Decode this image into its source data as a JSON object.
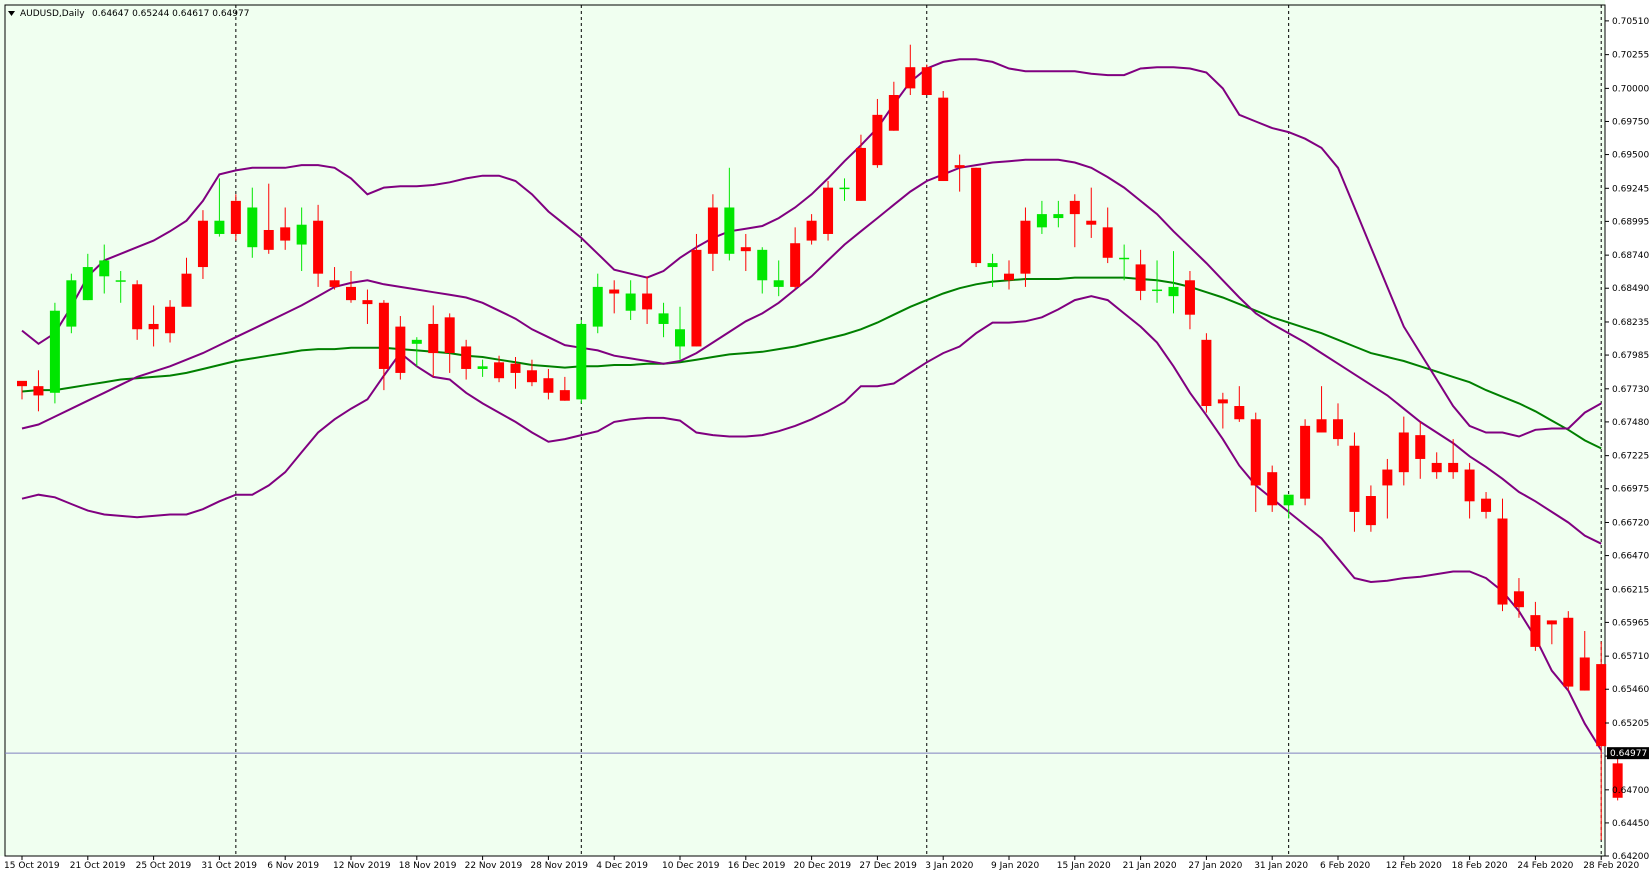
{
  "header": {
    "symbol": "AUDUSD,Daily",
    "ohlc": "0.64647 0.65244 0.64617 0.64977"
  },
  "colors": {
    "background": "#f0fff0",
    "bull": "#00e600",
    "bear": "#ff0000",
    "bands": "#800080",
    "ma": "#008000",
    "bid_line": "#8080c0",
    "grid": "#000000"
  },
  "current_price_label": "0.64977",
  "chart_data": {
    "type": "candlestick",
    "title": "AUDUSD,Daily",
    "ylim": [
      0.642,
      0.7063
    ],
    "y_ticks": [
      "0.70510",
      "0.70255",
      "0.70000",
      "0.69750",
      "0.69500",
      "0.69245",
      "0.68995",
      "0.68740",
      "0.68490",
      "0.68235",
      "0.67985",
      "0.67730",
      "0.67480",
      "0.67225",
      "0.66975",
      "0.66720",
      "0.66470",
      "0.66215",
      "0.65965",
      "0.65710",
      "0.65460",
      "0.65205",
      "0.64955",
      "0.64700",
      "0.64450",
      "0.64200"
    ],
    "x_labels": [
      {
        "i": 0,
        "t": "15 Oct 2019"
      },
      {
        "i": 4,
        "t": "21 Oct 2019"
      },
      {
        "i": 8,
        "t": "25 Oct 2019"
      },
      {
        "i": 12,
        "t": "31 Oct 2019"
      },
      {
        "i": 16,
        "t": "6 Nov 2019"
      },
      {
        "i": 20,
        "t": "12 Nov 2019"
      },
      {
        "i": 24,
        "t": "18 Nov 2019"
      },
      {
        "i": 28,
        "t": "22 Nov 2019"
      },
      {
        "i": 32,
        "t": "28 Nov 2019"
      },
      {
        "i": 36,
        "t": "4 Dec 2019"
      },
      {
        "i": 40,
        "t": "10 Dec 2019"
      },
      {
        "i": 44,
        "t": "16 Dec 2019"
      },
      {
        "i": 48,
        "t": "20 Dec 2019"
      },
      {
        "i": 52,
        "t": "27 Dec 2019"
      },
      {
        "i": 56,
        "t": "3 Jan 2020"
      },
      {
        "i": 60,
        "t": "9 Jan 2020"
      },
      {
        "i": 64,
        "t": "15 Jan 2020"
      },
      {
        "i": 68,
        "t": "21 Jan 2020"
      },
      {
        "i": 72,
        "t": "27 Jan 2020"
      },
      {
        "i": 76,
        "t": "31 Jan 2020"
      },
      {
        "i": 80,
        "t": "6 Feb 2020"
      },
      {
        "i": 84,
        "t": "12 Feb 2020"
      },
      {
        "i": 88,
        "t": "18 Feb 2020"
      },
      {
        "i": 92,
        "t": "24 Feb 2020"
      },
      {
        "i": 96,
        "t": "28 Feb 2020"
      }
    ],
    "period_separators": [
      13,
      34,
      55,
      77,
      96
    ],
    "current_price": 0.64977,
    "candles": [
      [
        0.6779,
        0.6778,
        0.6765,
        0.6775
      ],
      [
        0.6775,
        0.6787,
        0.6756,
        0.6768
      ],
      [
        0.677,
        0.6838,
        0.6762,
        0.6832
      ],
      [
        0.682,
        0.686,
        0.6815,
        0.6855
      ],
      [
        0.684,
        0.6875,
        0.684,
        0.6865
      ],
      [
        0.6858,
        0.6882,
        0.6845,
        0.687
      ],
      [
        0.6855,
        0.6862,
        0.6838,
        0.6855
      ],
      [
        0.6852,
        0.6855,
        0.681,
        0.6818
      ],
      [
        0.6822,
        0.6836,
        0.6805,
        0.6818
      ],
      [
        0.6835,
        0.684,
        0.6808,
        0.6815
      ],
      [
        0.686,
        0.6872,
        0.6845,
        0.6835
      ],
      [
        0.69,
        0.6908,
        0.6856,
        0.6865
      ],
      [
        0.689,
        0.6932,
        0.6888,
        0.69
      ],
      [
        0.6915,
        0.692,
        0.6885,
        0.689
      ],
      [
        0.688,
        0.6925,
        0.6872,
        0.691
      ],
      [
        0.6893,
        0.6928,
        0.6875,
        0.6878
      ],
      [
        0.6895,
        0.691,
        0.6878,
        0.6885
      ],
      [
        0.6882,
        0.691,
        0.6862,
        0.6897
      ],
      [
        0.69,
        0.6912,
        0.685,
        0.686
      ],
      [
        0.6855,
        0.6865,
        0.6848,
        0.685
      ],
      [
        0.685,
        0.6862,
        0.6838,
        0.684
      ],
      [
        0.684,
        0.6848,
        0.6822,
        0.6837
      ],
      [
        0.6838,
        0.684,
        0.6772,
        0.6788
      ],
      [
        0.682,
        0.6828,
        0.678,
        0.6785
      ],
      [
        0.6807,
        0.6812,
        0.679,
        0.681
      ],
      [
        0.6822,
        0.6836,
        0.6782,
        0.68
      ],
      [
        0.6827,
        0.683,
        0.6785,
        0.68
      ],
      [
        0.6805,
        0.681,
        0.678,
        0.6788
      ],
      [
        0.6788,
        0.6795,
        0.6782,
        0.679
      ],
      [
        0.6793,
        0.6798,
        0.6778,
        0.6781
      ],
      [
        0.6792,
        0.6797,
        0.6773,
        0.6785
      ],
      [
        0.6787,
        0.6795,
        0.6775,
        0.6778
      ],
      [
        0.6781,
        0.6788,
        0.6765,
        0.677
      ],
      [
        0.6772,
        0.6782,
        0.6764,
        0.6764
      ],
      [
        0.6765,
        0.6825,
        0.6762,
        0.6822
      ],
      [
        0.682,
        0.686,
        0.6815,
        0.685
      ],
      [
        0.6848,
        0.6855,
        0.683,
        0.6845
      ],
      [
        0.6832,
        0.6855,
        0.6825,
        0.6845
      ],
      [
        0.6845,
        0.6858,
        0.6822,
        0.6833
      ],
      [
        0.6822,
        0.6838,
        0.6812,
        0.683
      ],
      [
        0.6805,
        0.6835,
        0.6795,
        0.6818
      ],
      [
        0.6878,
        0.689,
        0.6805,
        0.6805
      ],
      [
        0.691,
        0.692,
        0.6862,
        0.6875
      ],
      [
        0.6875,
        0.694,
        0.687,
        0.691
      ],
      [
        0.688,
        0.689,
        0.6862,
        0.6877
      ],
      [
        0.6855,
        0.688,
        0.6845,
        0.6878
      ],
      [
        0.685,
        0.687,
        0.6843,
        0.6855
      ],
      [
        0.6883,
        0.6895,
        0.6848,
        0.685
      ],
      [
        0.69,
        0.6905,
        0.6882,
        0.6885
      ],
      [
        0.6925,
        0.693,
        0.6885,
        0.689
      ],
      [
        0.6925,
        0.6932,
        0.6915,
        0.6925
      ],
      [
        0.6955,
        0.6965,
        0.6915,
        0.6915
      ],
      [
        0.698,
        0.6992,
        0.694,
        0.6942
      ],
      [
        0.6995,
        0.7005,
        0.6968,
        0.6968
      ],
      [
        0.7016,
        0.7033,
        0.6995,
        0.7
      ],
      [
        0.7016,
        0.7018,
        0.6995,
        0.6995
      ],
      [
        0.6993,
        0.6998,
        0.693,
        0.693
      ],
      [
        0.6942,
        0.695,
        0.6922,
        0.694
      ],
      [
        0.694,
        0.694,
        0.6865,
        0.6868
      ],
      [
        0.6865,
        0.6875,
        0.685,
        0.6868
      ],
      [
        0.686,
        0.687,
        0.6848,
        0.6855
      ],
      [
        0.69,
        0.691,
        0.685,
        0.686
      ],
      [
        0.6895,
        0.6915,
        0.689,
        0.6905
      ],
      [
        0.6902,
        0.6915,
        0.6895,
        0.6905
      ],
      [
        0.6915,
        0.692,
        0.688,
        0.6905
      ],
      [
        0.69,
        0.6925,
        0.6887,
        0.6897
      ],
      [
        0.6895,
        0.691,
        0.6868,
        0.6872
      ],
      [
        0.6872,
        0.6882,
        0.6855,
        0.6872
      ],
      [
        0.6867,
        0.6878,
        0.684,
        0.6847
      ],
      [
        0.6848,
        0.687,
        0.6838,
        0.6848
      ],
      [
        0.6843,
        0.6877,
        0.683,
        0.685
      ],
      [
        0.6855,
        0.6862,
        0.6818,
        0.6829
      ],
      [
        0.681,
        0.6815,
        0.6755,
        0.676
      ],
      [
        0.6765,
        0.677,
        0.6743,
        0.6762
      ],
      [
        0.676,
        0.6775,
        0.6748,
        0.675
      ],
      [
        0.675,
        0.6755,
        0.668,
        0.67
      ],
      [
        0.671,
        0.6715,
        0.668,
        0.6685
      ],
      [
        0.6685,
        0.6693,
        0.6675,
        0.6693
      ],
      [
        0.6745,
        0.675,
        0.6685,
        0.669
      ],
      [
        0.675,
        0.6775,
        0.674,
        0.674
      ],
      [
        0.675,
        0.6762,
        0.673,
        0.6735
      ],
      [
        0.673,
        0.674,
        0.6665,
        0.668
      ],
      [
        0.6692,
        0.67,
        0.6665,
        0.667
      ],
      [
        0.6712,
        0.672,
        0.6675,
        0.67
      ],
      [
        0.674,
        0.6752,
        0.67,
        0.671
      ],
      [
        0.6738,
        0.6748,
        0.6705,
        0.672
      ],
      [
        0.6717,
        0.6725,
        0.6705,
        0.671
      ],
      [
        0.6717,
        0.6735,
        0.6705,
        0.671
      ],
      [
        0.6712,
        0.6717,
        0.6675,
        0.6688
      ],
      [
        0.669,
        0.6695,
        0.6675,
        0.668
      ],
      [
        0.6675,
        0.669,
        0.6605,
        0.661
      ],
      [
        0.662,
        0.663,
        0.66,
        0.6608
      ],
      [
        0.6602,
        0.6612,
        0.6575,
        0.6578
      ],
      [
        0.6598,
        0.6598,
        0.658,
        0.6595
      ],
      [
        0.66,
        0.6605,
        0.6545,
        0.6548
      ],
      [
        0.657,
        0.659,
        0.6545,
        0.6545
      ],
      [
        0.6565,
        0.6582,
        0.6432,
        0.6503
      ],
      [
        0.649,
        0.6498,
        0.6462,
        0.6464
      ]
    ],
    "bands_upper": [
      0.6817,
      0.6807,
      0.6815,
      0.6835,
      0.6858,
      0.687,
      0.6875,
      0.688,
      0.6885,
      0.6892,
      0.69,
      0.6915,
      0.6935,
      0.6938,
      0.694,
      0.694,
      0.694,
      0.6942,
      0.6942,
      0.694,
      0.6932,
      0.692,
      0.6925,
      0.6926,
      0.6926,
      0.6927,
      0.6929,
      0.6932,
      0.6934,
      0.6934,
      0.693,
      0.692,
      0.6907,
      0.6897,
      0.6887,
      0.6875,
      0.6863,
      0.686,
      0.6857,
      0.6862,
      0.6872,
      0.688,
      0.6887,
      0.6892,
      0.6894,
      0.6896,
      0.6902,
      0.691,
      0.692,
      0.6932,
      0.6945,
      0.6957,
      0.697,
      0.6988,
      0.7005,
      0.7015,
      0.702,
      0.7022,
      0.7022,
      0.702,
      0.7015,
      0.7013,
      0.7013,
      0.7013,
      0.7013,
      0.7011,
      0.701,
      0.701,
      0.7015,
      0.7016,
      0.7016,
      0.7015,
      0.7012,
      0.7,
      0.698,
      0.6975,
      0.697,
      0.6967,
      0.6962,
      0.6955,
      0.694,
      0.691,
      0.688,
      0.685,
      0.682,
      0.68,
      0.678,
      0.676,
      0.6745,
      0.674,
      0.674,
      0.6737,
      0.6742,
      0.6743,
      0.6743,
      0.6755,
      0.6762
    ],
    "bands_middle": [
      0.6743,
      0.6746,
      0.6752,
      0.6758,
      0.6764,
      0.677,
      0.6776,
      0.6782,
      0.6786,
      0.679,
      0.6795,
      0.68,
      0.6806,
      0.6812,
      0.6818,
      0.6824,
      0.683,
      0.6836,
      0.6843,
      0.685,
      0.6853,
      0.6855,
      0.6852,
      0.685,
      0.6848,
      0.6846,
      0.6844,
      0.6842,
      0.6838,
      0.6832,
      0.6826,
      0.6818,
      0.6812,
      0.6806,
      0.6804,
      0.6802,
      0.6798,
      0.6796,
      0.6794,
      0.6792,
      0.6794,
      0.68,
      0.6808,
      0.6816,
      0.6824,
      0.683,
      0.6838,
      0.6848,
      0.6858,
      0.687,
      0.6882,
      0.6892,
      0.6902,
      0.6912,
      0.6922,
      0.693,
      0.6935,
      0.694,
      0.6942,
      0.6944,
      0.6945,
      0.6946,
      0.6946,
      0.6946,
      0.6944,
      0.694,
      0.6933,
      0.6925,
      0.6915,
      0.6905,
      0.6892,
      0.688,
      0.6868,
      0.6855,
      0.6842,
      0.683,
      0.6822,
      0.6815,
      0.6808,
      0.68,
      0.6792,
      0.6784,
      0.6776,
      0.6768,
      0.6758,
      0.6748,
      0.674,
      0.6732,
      0.6722,
      0.6714,
      0.6705,
      0.6695,
      0.6688,
      0.668,
      0.6672,
      0.6662,
      0.6656
    ],
    "ma": [
      0.6771,
      0.6772,
      0.6772,
      0.6774,
      0.6776,
      0.6778,
      0.678,
      0.6781,
      0.6782,
      0.6783,
      0.6785,
      0.6788,
      0.6791,
      0.6794,
      0.6796,
      0.6798,
      0.68,
      0.6802,
      0.6803,
      0.6803,
      0.6804,
      0.6804,
      0.6804,
      0.6803,
      0.6802,
      0.6801,
      0.68,
      0.6798,
      0.6797,
      0.6795,
      0.6793,
      0.6791,
      0.679,
      0.6789,
      0.679,
      0.679,
      0.6791,
      0.6791,
      0.6792,
      0.6792,
      0.6793,
      0.6795,
      0.6797,
      0.6799,
      0.68,
      0.6801,
      0.6803,
      0.6805,
      0.6808,
      0.6811,
      0.6814,
      0.6818,
      0.6823,
      0.6829,
      0.6835,
      0.684,
      0.6845,
      0.6849,
      0.6852,
      0.6854,
      0.6855,
      0.6856,
      0.6856,
      0.6856,
      0.6857,
      0.6857,
      0.6857,
      0.6857,
      0.6856,
      0.6855,
      0.6853,
      0.685,
      0.6846,
      0.6842,
      0.6837,
      0.6832,
      0.6827,
      0.6823,
      0.6819,
      0.6815,
      0.681,
      0.6805,
      0.68,
      0.6797,
      0.6794,
      0.679,
      0.6786,
      0.6782,
      0.6778,
      0.6772,
      0.6767,
      0.6762,
      0.6756,
      0.6749,
      0.6742,
      0.6734,
      0.6728
    ],
    "bands_lower": [
      0.669,
      0.6693,
      0.6691,
      0.6686,
      0.6681,
      0.6678,
      0.6677,
      0.6676,
      0.6677,
      0.6678,
      0.6678,
      0.6682,
      0.6688,
      0.6693,
      0.6693,
      0.67,
      0.671,
      0.6725,
      0.674,
      0.675,
      0.6758,
      0.6765,
      0.6783,
      0.68,
      0.679,
      0.6782,
      0.678,
      0.677,
      0.6762,
      0.6755,
      0.6748,
      0.674,
      0.6733,
      0.6735,
      0.6738,
      0.6741,
      0.6748,
      0.675,
      0.6751,
      0.6751,
      0.6749,
      0.674,
      0.6738,
      0.6737,
      0.6737,
      0.6738,
      0.6741,
      0.6745,
      0.675,
      0.6756,
      0.6763,
      0.6775,
      0.6775,
      0.6777,
      0.6785,
      0.6793,
      0.68,
      0.6805,
      0.6815,
      0.6823,
      0.6823,
      0.6824,
      0.6827,
      0.6833,
      0.684,
      0.6843,
      0.684,
      0.683,
      0.682,
      0.6808,
      0.679,
      0.677,
      0.6753,
      0.6735,
      0.6715,
      0.67,
      0.669,
      0.668,
      0.667,
      0.666,
      0.6645,
      0.663,
      0.6627,
      0.6628,
      0.663,
      0.6631,
      0.6633,
      0.6635,
      0.6635,
      0.663,
      0.662,
      0.6605,
      0.6585,
      0.656,
      0.6545,
      0.652,
      0.65
    ]
  }
}
